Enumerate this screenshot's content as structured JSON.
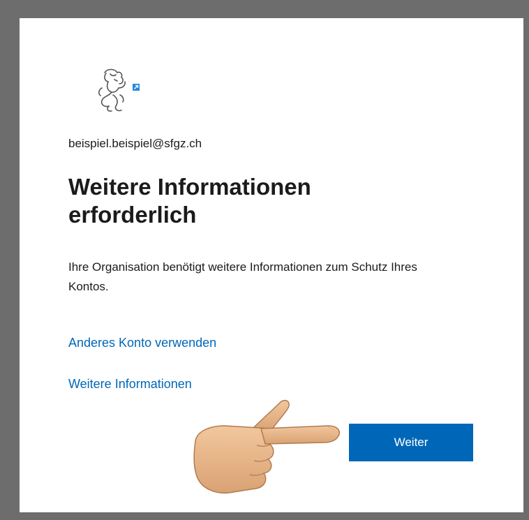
{
  "account": {
    "email": "beispiel.beispiel@sfgz.ch"
  },
  "dialog": {
    "title": "Weitere Informationen erforderlich",
    "description": "Ihre Organisation benötigt weitere Informationen zum Schutz Ihres Kontos."
  },
  "links": {
    "other_account": "Anderes Konto verwenden",
    "more_info": "Weitere Informationen"
  },
  "actions": {
    "next_label": "Weiter"
  },
  "icons": {
    "logo": "zurich-lion-logo-icon",
    "badge": "expand-arrow-icon",
    "pointer": "pointing-hand-icon"
  },
  "colors": {
    "accent": "#0067b8",
    "text": "#1b1b1b",
    "frame": "#6d6d6d",
    "card": "#ffffff"
  }
}
